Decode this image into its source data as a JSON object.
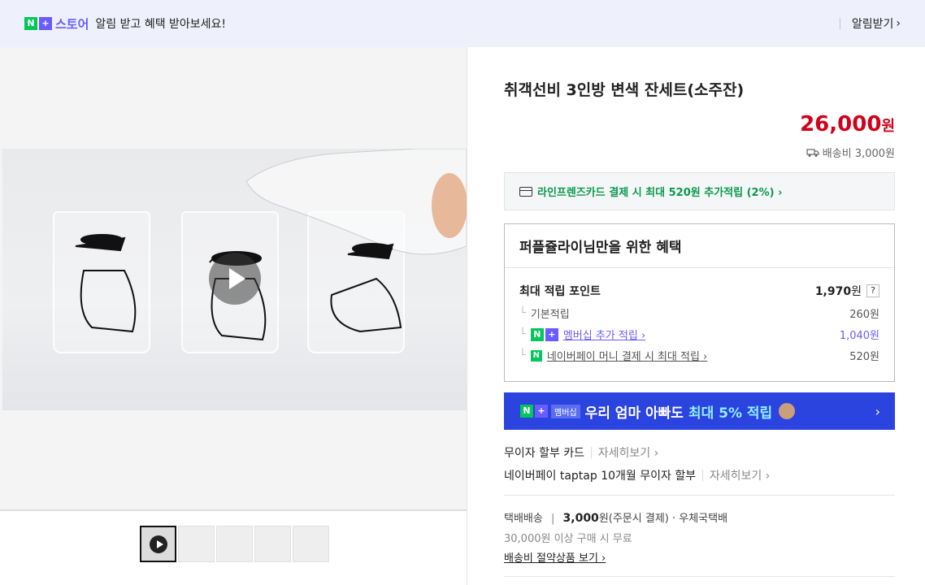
{
  "topbar": {
    "badge_n": "N",
    "badge_plus": "+",
    "brand": "스토어",
    "message": "알림 받고 혜택 받아보세요!",
    "action": "알림받기",
    "action_chevron": "›"
  },
  "media": {
    "play_icon": "play-icon",
    "thumbnails_count": 5
  },
  "product": {
    "title": "취객선비 3인방 변색 잔세트(소주잔)",
    "price": "26,000",
    "currency": "원",
    "shipping": "배송비 3,000원"
  },
  "card_benefit": {
    "text": "라인프렌즈카드 결제 시 최대 520원 추가적립 (2%) ›"
  },
  "benefit_box": {
    "header": "퍼플쥴라이님만을 위한 혜택",
    "max_points_label": "최대 적립 포인트",
    "max_points_value": "1,970",
    "max_points_unit": "원",
    "help": "?",
    "rows": [
      {
        "label": "기본적립",
        "value": "260원"
      },
      {
        "label": "멤버십 추가 적립 ›",
        "value": "1,040원"
      },
      {
        "label": "네이버페이 머니 결제 시 최대 적립 ›",
        "value": "520원"
      }
    ]
  },
  "promo": {
    "badge": "멤버십",
    "text": "우리 엄마 아빠도",
    "highlight": "최대 5% 적립",
    "arrow": "›"
  },
  "installments": {
    "card_label": "무이자 할부 카드",
    "card_more": "자세히보기 ›",
    "npay_label": "네이버페이 taptap 10개월 무이자 할부",
    "npay_more": "자세히보기 ›"
  },
  "delivery": {
    "type": "택배배송",
    "fee": "3,000",
    "fee_note": "원(주문시 결제)",
    "carrier": "· 우체국택배",
    "free_over": "30,000원 이상 구매 시 무료",
    "saving_link": "배송비 절약상품 보기 ›"
  },
  "colors": {
    "accent_purple": "#6a5cff",
    "price_red": "#d0021b",
    "naver_green": "#03c75a",
    "promo_blue": "#2b44e0"
  }
}
